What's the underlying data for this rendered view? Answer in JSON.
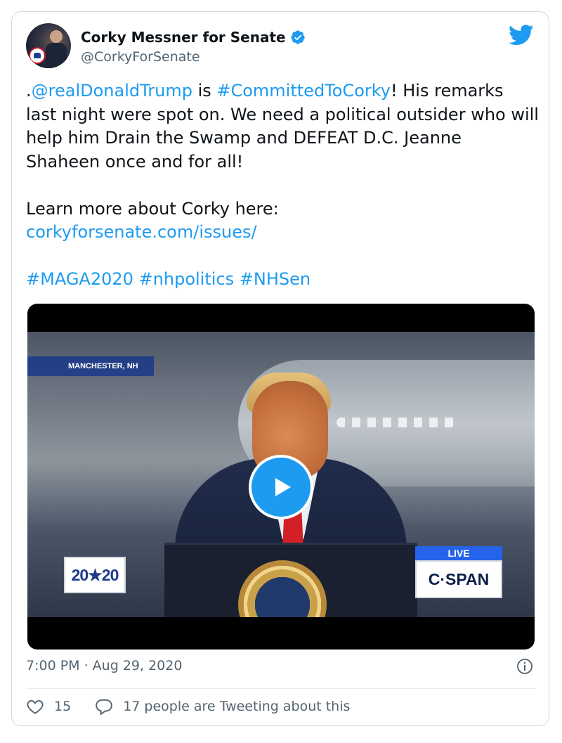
{
  "author": {
    "display_name": "Corky Messner for Senate",
    "handle": "@CorkyForSenate",
    "avatar_icon": "profile-photo",
    "verified_icon": "verified-badge-icon"
  },
  "tweet": {
    "para1": {
      "prefix": ".",
      "mention": "@realDonaldTrump",
      "mid": " is ",
      "hashtag": "#CommittedToCorky",
      "rest": "! His remarks last night were spot on. We need a political outsider who will help him Drain the Swamp and DEFEAT D.C. Jeanne Shaheen once and for all!"
    },
    "para2": {
      "text": "Learn more about Corky here:",
      "link": "corkyforsenate.com/issues/"
    },
    "hashtags": [
      "#MAGA2020",
      "#nhpolitics",
      "#NHSen"
    ]
  },
  "media": {
    "location_label": "MANCHESTER, NH",
    "badge_2020": "20★20",
    "cspan_live": "LIVE",
    "cspan_logo": "C·SPAN",
    "play_icon": "play-icon"
  },
  "meta": {
    "timestamp": "7:00 PM · Aug 29, 2020"
  },
  "actions": {
    "like_count": "15",
    "conversation_text": "17 people are Tweeting about this"
  },
  "colors": {
    "link": "#1d9bf0",
    "secondary_text": "#536471",
    "border": "#cfd9de"
  }
}
